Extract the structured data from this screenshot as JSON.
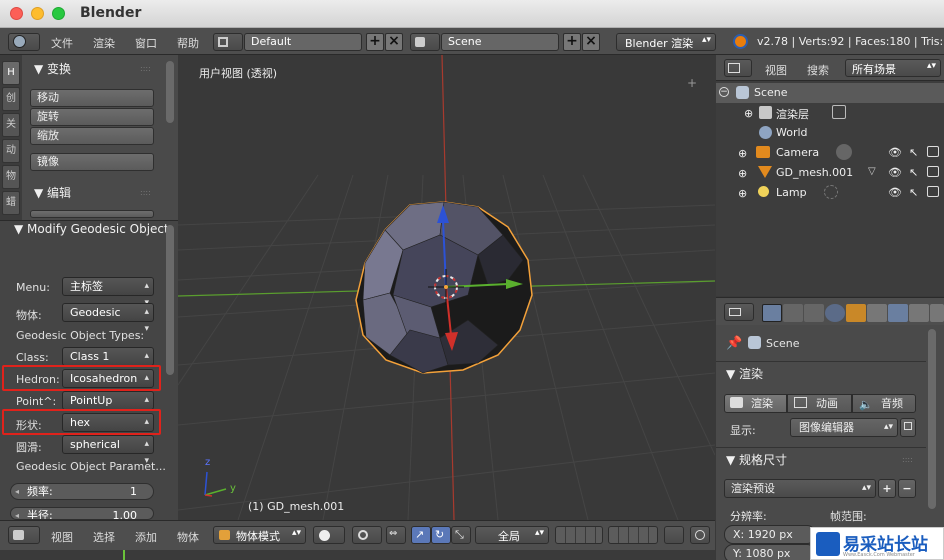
{
  "window": {
    "title": "Blender"
  },
  "topbar": {
    "menus": [
      "文件",
      "渲染",
      "窗口",
      "帮助"
    ],
    "layout": "Default",
    "scene": "Scene",
    "engine": "Blender 渲染",
    "stats": "v2.78 | Verts:92 | Faces:180 | Tris:1("
  },
  "toolshelf": {
    "tabs": [
      "H",
      "创",
      "关",
      "动",
      "物",
      "蜡"
    ],
    "transform_header": "变换",
    "transform_buttons": [
      "移动",
      "旋转",
      "缩放"
    ],
    "mirror_button": "镜像",
    "edit_header": "编辑",
    "operator_header": "Modify Geodesic Object",
    "fields": [
      {
        "label": "Menu:",
        "value": "主标签"
      },
      {
        "label": "物体:",
        "value": "Geodesic"
      }
    ],
    "types_label": "Geodesic Object Types:",
    "type_fields": [
      {
        "label": "Class:",
        "value": "Class 1"
      },
      {
        "label": "Hedron:",
        "value": "Icosahedron"
      },
      {
        "label": "Point^:",
        "value": "PointUp"
      },
      {
        "label": "形状:",
        "value": "hex"
      },
      {
        "label": "圆滑:",
        "value": "spherical"
      }
    ],
    "params_label": "Geodesic Object Paramet...",
    "freq_label": "频率:",
    "freq_value": "1",
    "radius_label": "半径:",
    "radius_value": "1.00"
  },
  "viewport": {
    "view_label": "用户视图 (透视)",
    "object_label": "(1) GD_mesh.001",
    "axis_z": "z",
    "axis_y": "y"
  },
  "outliner": {
    "view": "视图",
    "search": "搜索",
    "filter": "所有场景",
    "items": [
      "Scene",
      "渲染层",
      "World",
      "Camera",
      "GD_mesh.001",
      "Lamp"
    ]
  },
  "properties": {
    "scene_label": "Scene",
    "render_header": "渲染",
    "render_buttons": [
      "渲染",
      "动画",
      "音频"
    ],
    "display_label": "显示:",
    "display_value": "图像编辑器",
    "dimensions_header": "规格尺寸",
    "preset": "渲染预设",
    "resolution_label": "分辨率:",
    "frame_range_label": "帧范围:",
    "res_x": "X:  1920 px",
    "res_y": "Y:  1080 px"
  },
  "bottombar": {
    "menus": [
      "视图",
      "选择",
      "添加",
      "物体"
    ],
    "mode": "物体模式",
    "orientation": "全局"
  },
  "watermark": {
    "text": "易采站长站",
    "sub": "Www.Easck.Com  Webmaster"
  },
  "colors": {
    "accent_red_box": "#e0221b",
    "selection_orange": "#f3a13a",
    "axis_x": "#c0392b",
    "axis_y": "#5a9e2e",
    "axis_z": "#2c52d6"
  }
}
